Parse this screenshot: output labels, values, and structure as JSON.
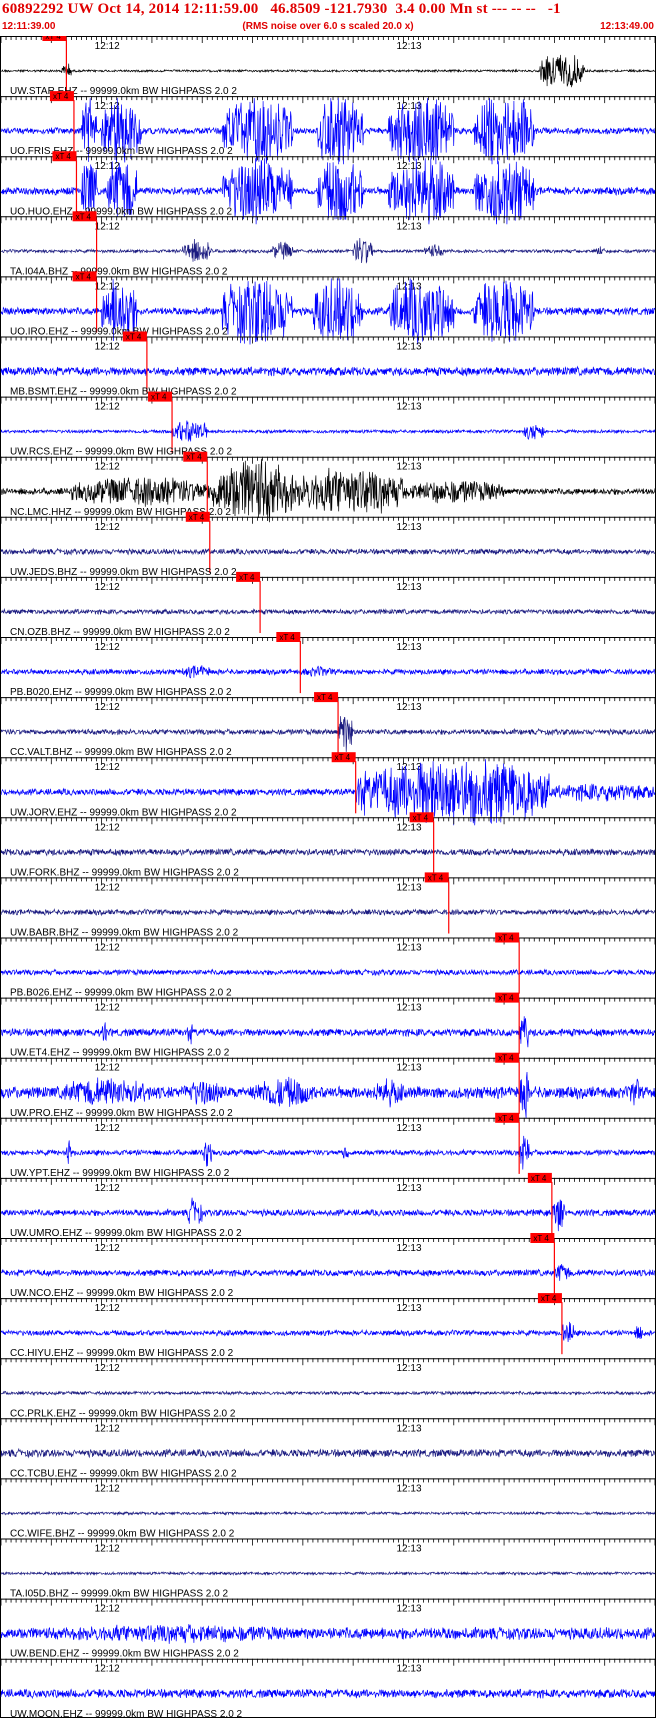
{
  "header": {
    "title": "60892292 UW Oct 14, 2014 12:11:59.00   46.8509 -121.7930  3.4 0.00 Mn st --- -- --   -1",
    "start_time": "12:11:39.00",
    "subtitle": "(RMS noise over 6.0 s scaled 20.0 x)",
    "end_time": "12:13:49.00"
  },
  "chart_data": {
    "type": "line",
    "title": "60892292 UW Oct 14, 2014 12:11:59.00   46.8509 -121.7930  3.4 0.00 Mn st --- -- --   -1",
    "x_start_s": 0,
    "x_end_s": 130,
    "minute_marks": [
      {
        "label": "12:12",
        "t": 21
      },
      {
        "label": "12:13",
        "t": 81
      }
    ],
    "pick_label": "xT 4",
    "colors": {
      "blue": "#0000ff",
      "navy": "#1a1a80",
      "black": "#000000",
      "pick": "#ff0000",
      "pick_text": "#000000"
    },
    "grid": true,
    "series": [
      {
        "name": "UW.STAR.EHZ -- 99999.0km BW  HIGHPASS  2.0  2",
        "color": "black",
        "pick_s": 13.0,
        "amp": 0.04,
        "bursts": [
          [
            107,
            116,
            0.7
          ],
          [
            12,
            14,
            0.3
          ]
        ]
      },
      {
        "name": "UO.FRIS.EHZ -- 99999.0km BW  HIGHPASS  2.0  2",
        "color": "blue",
        "pick_s": 14.5,
        "amp": 0.12,
        "bursts": [
          [
            16,
            19,
            1.4
          ],
          [
            20,
            28,
            1.3
          ],
          [
            44,
            58,
            1.3
          ],
          [
            63,
            72,
            1.4
          ],
          [
            77,
            90,
            1.4
          ],
          [
            94,
            106,
            1.4
          ]
        ]
      },
      {
        "name": "UO.HUO.EHZ -- 99999.0km BW  HIGHPASS  2.0  2",
        "color": "blue",
        "pick_s": 15.0,
        "amp": 0.14,
        "bursts": [
          [
            16,
            19,
            1.3
          ],
          [
            21,
            27,
            1.3
          ],
          [
            44,
            58,
            1.3
          ],
          [
            63,
            72,
            1.3
          ],
          [
            77,
            90,
            1.3
          ],
          [
            94,
            106,
            1.3
          ]
        ]
      },
      {
        "name": "TA.I04A.BHZ -- 99999.0km BW  HIGHPASS  2.0  2",
        "color": "navy",
        "pick_s": 19.0,
        "amp": 0.06,
        "bursts": [
          [
            36,
            42,
            0.45
          ],
          [
            54,
            58,
            0.35
          ],
          [
            70,
            74,
            0.55
          ],
          [
            84,
            88,
            0.25
          ],
          [
            118,
            120,
            0.2
          ]
        ]
      },
      {
        "name": "UO.IRO.EHZ -- 99999.0km BW  HIGHPASS  2.0  2",
        "color": "blue",
        "pick_s": 19.0,
        "amp": 0.14,
        "bursts": [
          [
            20,
            27,
            1.3
          ],
          [
            44,
            58,
            1.3
          ],
          [
            62,
            72,
            1.3
          ],
          [
            77,
            90,
            1.3
          ],
          [
            94,
            106,
            1.3
          ]
        ]
      },
      {
        "name": "MB.BSMT.EHZ -- 99999.0km BW  HIGHPASS  2.0  2",
        "color": "blue",
        "pick_s": 29.0,
        "amp": 0.16,
        "bursts": []
      },
      {
        "name": "UW.RCS.EHZ -- 99999.0km BW  HIGHPASS  2.0  2",
        "color": "blue",
        "pick_s": 34.0,
        "amp": 0.06,
        "bursts": [
          [
            34,
            41,
            0.45
          ],
          [
            104,
            108,
            0.35
          ]
        ]
      },
      {
        "name": "NC.LMC.HHZ -- 99999.0km BW  HIGHPASS  2.0  2",
        "color": "black",
        "pick_s": 41.0,
        "amp": 0.12,
        "bursts": [
          [
            14,
            42,
            0.55
          ],
          [
            42,
            58,
            1.25
          ],
          [
            58,
            80,
            0.9
          ],
          [
            80,
            100,
            0.45
          ]
        ]
      },
      {
        "name": "UW.JEDS.BHZ -- 99999.0km BW  HIGHPASS  2.0  2",
        "color": "navy",
        "pick_s": 41.5,
        "amp": 0.1,
        "bursts": []
      },
      {
        "name": "CN.OZB.BHZ -- 99999.0km BW  HIGHPASS  2.0  2",
        "color": "navy",
        "pick_s": 51.5,
        "amp": 0.09,
        "bursts": []
      },
      {
        "name": "PB.B020.EHZ -- 99999.0km BW  HIGHPASS  2.0  2",
        "color": "blue",
        "pick_s": 59.5,
        "amp": 0.1,
        "bursts": [
          [
            36,
            42,
            0.25
          ],
          [
            60,
            66,
            0.2
          ]
        ]
      },
      {
        "name": "CC.VALT.BHZ -- 99999.0km BW  HIGHPASS  2.0  2",
        "color": "navy",
        "pick_s": 67.0,
        "amp": 0.1,
        "bursts": [
          [
            67,
            70,
            0.8
          ]
        ]
      },
      {
        "name": "UW.JORV.EHZ -- 99999.0km BW  HIGHPASS  2.0  2",
        "color": "blue",
        "pick_s": 70.5,
        "amp": 0.12,
        "bursts": [
          [
            70.5,
            73,
            0.9
          ],
          [
            73,
            109,
            1.35
          ],
          [
            109,
            130,
            0.35
          ]
        ]
      },
      {
        "name": "UW.FORK.BHZ -- 99999.0km BW  HIGHPASS  2.0  2",
        "color": "navy",
        "pick_s": 86.0,
        "amp": 0.12,
        "bursts": []
      },
      {
        "name": "UW.BABR.BHZ -- 99999.0km BW  HIGHPASS  2.0  2",
        "color": "navy",
        "pick_s": 89.0,
        "amp": 0.1,
        "bursts": []
      },
      {
        "name": "PB.B026.EHZ -- 99999.0km BW  HIGHPASS  2.0  2",
        "color": "blue",
        "pick_s": 103.0,
        "amp": 0.1,
        "bursts": []
      },
      {
        "name": "UW.ET4.EHZ -- 99999.0km BW  HIGHPASS  2.0  2",
        "color": "blue",
        "pick_s": 103.0,
        "amp": 0.14,
        "bursts": [
          [
            103,
            105,
            0.75
          ],
          [
            20,
            21,
            0.5
          ],
          [
            37,
            38,
            0.5
          ]
        ]
      },
      {
        "name": "UW.PRO.EHZ -- 99999.0km BW  HIGHPASS  2.0  2",
        "color": "blue",
        "pick_s": 103.0,
        "amp": 0.22,
        "bursts": [
          [
            12,
            30,
            0.55
          ],
          [
            36,
            44,
            0.5
          ],
          [
            50,
            62,
            0.6
          ],
          [
            74,
            80,
            0.5
          ],
          [
            103,
            105,
            1.0
          ],
          [
            125,
            127,
            0.6
          ]
        ]
      },
      {
        "name": "UW.YPT.EHZ -- 99999.0km BW  HIGHPASS  2.0  2",
        "color": "blue",
        "pick_s": 103.0,
        "amp": 0.1,
        "bursts": [
          [
            103,
            105,
            0.8
          ],
          [
            13,
            14,
            0.6
          ],
          [
            40,
            42,
            0.5
          ],
          [
            68,
            69,
            0.4
          ]
        ]
      },
      {
        "name": "UW.UMRO.EHZ -- 99999.0km BW  HIGHPASS  2.0  2",
        "color": "blue",
        "pick_s": 109.5,
        "amp": 0.12,
        "bursts": [
          [
            109.5,
            112,
            0.7
          ],
          [
            37,
            40,
            0.55
          ]
        ]
      },
      {
        "name": "UW.NCO.EHZ -- 99999.0km BW  HIGHPASS  2.0  2",
        "color": "blue",
        "pick_s": 110.0,
        "amp": 0.12,
        "bursts": [
          [
            110,
            113,
            0.4
          ]
        ]
      },
      {
        "name": "CC.HIYU.EHZ -- 99999.0km BW  HIGHPASS  2.0  2",
        "color": "blue",
        "pick_s": 111.5,
        "amp": 0.1,
        "bursts": [
          [
            111.5,
            114,
            0.5
          ],
          [
            126,
            128,
            0.3
          ]
        ]
      },
      {
        "name": "CC.PRLK.EHZ -- 99999.0km BW  HIGHPASS  2.0  2",
        "color": "navy",
        "pick_s": null,
        "amp": 0.06,
        "bursts": []
      },
      {
        "name": "CC.TCBU.EHZ -- 99999.0km BW  HIGHPASS  2.0  2",
        "color": "navy",
        "pick_s": null,
        "amp": 0.14,
        "bursts": []
      },
      {
        "name": "CC.WIFE.BHZ -- 99999.0km BW  HIGHPASS  2.0  2",
        "color": "navy",
        "pick_s": null,
        "amp": 0.05,
        "bursts": []
      },
      {
        "name": "TA.I05D.BHZ -- 99999.0km BW  HIGHPASS  2.0  2",
        "color": "navy",
        "pick_s": null,
        "amp": 0.05,
        "bursts": []
      },
      {
        "name": "UW.BEND.EHZ -- 99999.0km BW  HIGHPASS  2.0  2",
        "color": "blue",
        "pick_s": null,
        "amp": 0.22,
        "bursts": [
          [
            10,
            60,
            0.35
          ]
        ]
      },
      {
        "name": "UW.MOON.EHZ -- 99999.0km BW  HIGHPASS  2.0  2",
        "color": "blue",
        "pick_s": null,
        "amp": 0.16,
        "bursts": []
      }
    ]
  }
}
